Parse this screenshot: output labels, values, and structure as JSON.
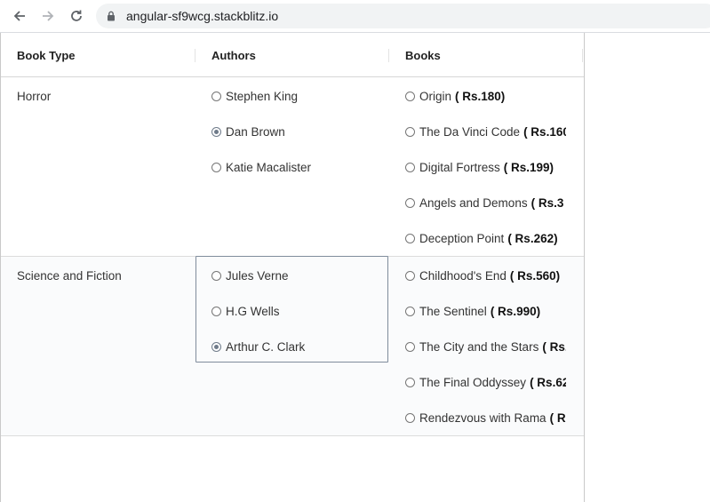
{
  "browser": {
    "url": "angular-sf9wcg.stackblitz.io"
  },
  "table": {
    "headers": [
      "Book Type",
      "Authors",
      "Books"
    ],
    "rows": [
      {
        "type": "Horror",
        "authors": [
          {
            "name": "Stephen King",
            "checked": false
          },
          {
            "name": "Dan Brown",
            "checked": true
          },
          {
            "name": "Katie Macalister",
            "checked": false
          }
        ],
        "books": [
          {
            "title": "Origin",
            "price": "( Rs.180)"
          },
          {
            "title": "The Da Vinci Code",
            "price": "( Rs.160"
          },
          {
            "title": "Digital Fortress",
            "price": "( Rs.199)"
          },
          {
            "title": "Angels and Demons",
            "price": "( Rs.3"
          },
          {
            "title": "Deception Point",
            "price": "( Rs.262)"
          }
        ]
      },
      {
        "type": "Science and Fiction",
        "authors": [
          {
            "name": "Jules Verne",
            "checked": false
          },
          {
            "name": "H.G Wells",
            "checked": false
          },
          {
            "name": "Arthur C. Clark",
            "checked": true
          }
        ],
        "books": [
          {
            "title": "Childhood's End",
            "price": "( Rs.560)"
          },
          {
            "title": "The Sentinel",
            "price": "( Rs.990)"
          },
          {
            "title": "The City and the Stars",
            "price": "( Rs."
          },
          {
            "title": "The Final Oddyssey",
            "price": "( Rs.62"
          },
          {
            "title": "Rendezvous with Rama",
            "price": "( R"
          }
        ]
      }
    ]
  }
}
